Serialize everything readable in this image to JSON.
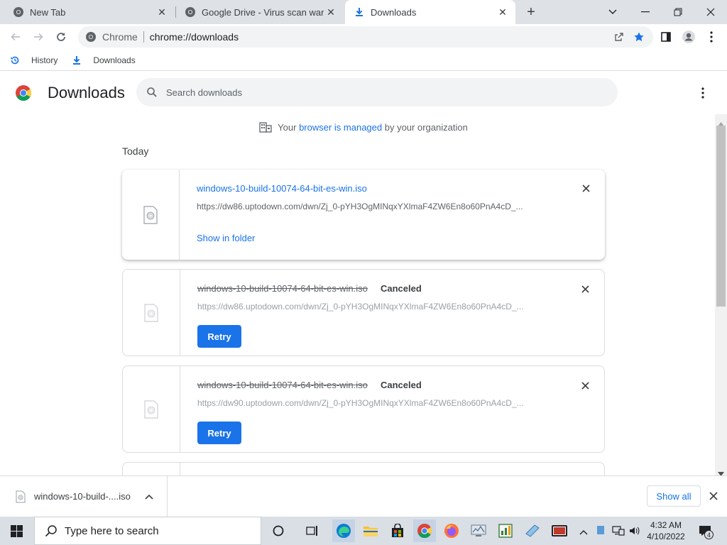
{
  "tabs": [
    {
      "title": "New Tab",
      "icon": "chrome-icon"
    },
    {
      "title": "Google Drive - Virus scan warning",
      "icon": "globe-icon"
    },
    {
      "title": "Downloads",
      "icon": "download-icon"
    }
  ],
  "toolbar": {
    "omnibox_chip": "Chrome",
    "omnibox_url": "chrome://downloads"
  },
  "bookmarks": [
    {
      "label": "History",
      "icon": "history-icon"
    },
    {
      "label": "Downloads",
      "icon": "download-icon"
    }
  ],
  "downloads_page": {
    "title": "Downloads",
    "search_placeholder": "Search downloads",
    "managed": {
      "prefix": "Your ",
      "link": "browser is managed",
      "suffix": " by your organization"
    },
    "section": "Today",
    "items": [
      {
        "file": "windows-10-build-10074-64-bit-es-win.iso",
        "url": "https://dw86.uptodown.com/dwn/Zj_0-pYH3OgMINqxYXlmaF4ZW6En8o60PnA4cD_...",
        "state": "complete",
        "action": "Show in folder"
      },
      {
        "file": "windows-10-build-10074-64-bit-es-win.iso",
        "url": "https://dw86.uptodown.com/dwn/Zj_0-pYH3OgMINqxYXlmaF4ZW6En8o60PnA4cD_...",
        "state": "Canceled",
        "action": "Retry"
      },
      {
        "file": "windows-10-build-10074-64-bit-es-win.iso",
        "url": "https://dw90.uptodown.com/dwn/Zj_0-pYH3OgMINqxYXlmaF4ZW6En8o60PnA4cD_...",
        "state": "Canceled",
        "action": "Retry"
      }
    ]
  },
  "shelf": {
    "file": "windows-10-build-....iso",
    "show_all": "Show all"
  },
  "taskbar": {
    "search_placeholder": "Type here to search",
    "time": "4:32 AM",
    "date": "4/10/2022",
    "notification_count": "4"
  },
  "colors": {
    "accent": "#1a73e8",
    "tabstrip": "#dee1e6",
    "taskbar": "#dadfe6"
  }
}
